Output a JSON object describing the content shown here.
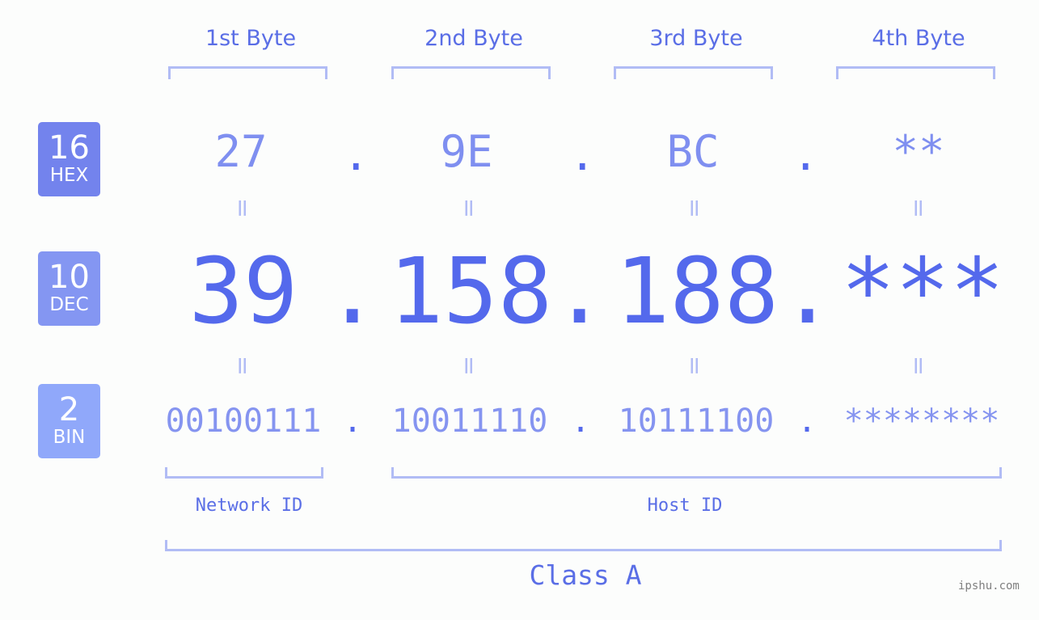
{
  "bytes": {
    "headers": [
      "1st Byte",
      "2nd Byte",
      "3rd Byte",
      "4th Byte"
    ]
  },
  "badges": {
    "hex": {
      "num": "16",
      "label": "HEX",
      "color": "#7383ed"
    },
    "dec": {
      "num": "10",
      "label": "DEC",
      "color": "#8496f2"
    },
    "bin": {
      "num": "2",
      "label": "BIN",
      "color": "#90a8fa"
    }
  },
  "values": {
    "hex": [
      "27",
      "9E",
      "BC",
      "**"
    ],
    "dec": [
      "39",
      "158",
      "188",
      "***"
    ],
    "bin": [
      "00100111",
      "10011110",
      "10111100",
      "********"
    ]
  },
  "separator": ".",
  "equals": "=",
  "parts": {
    "network": "Network ID",
    "host": "Host ID",
    "class": "Class A"
  },
  "watermark": "ipshu.com"
}
